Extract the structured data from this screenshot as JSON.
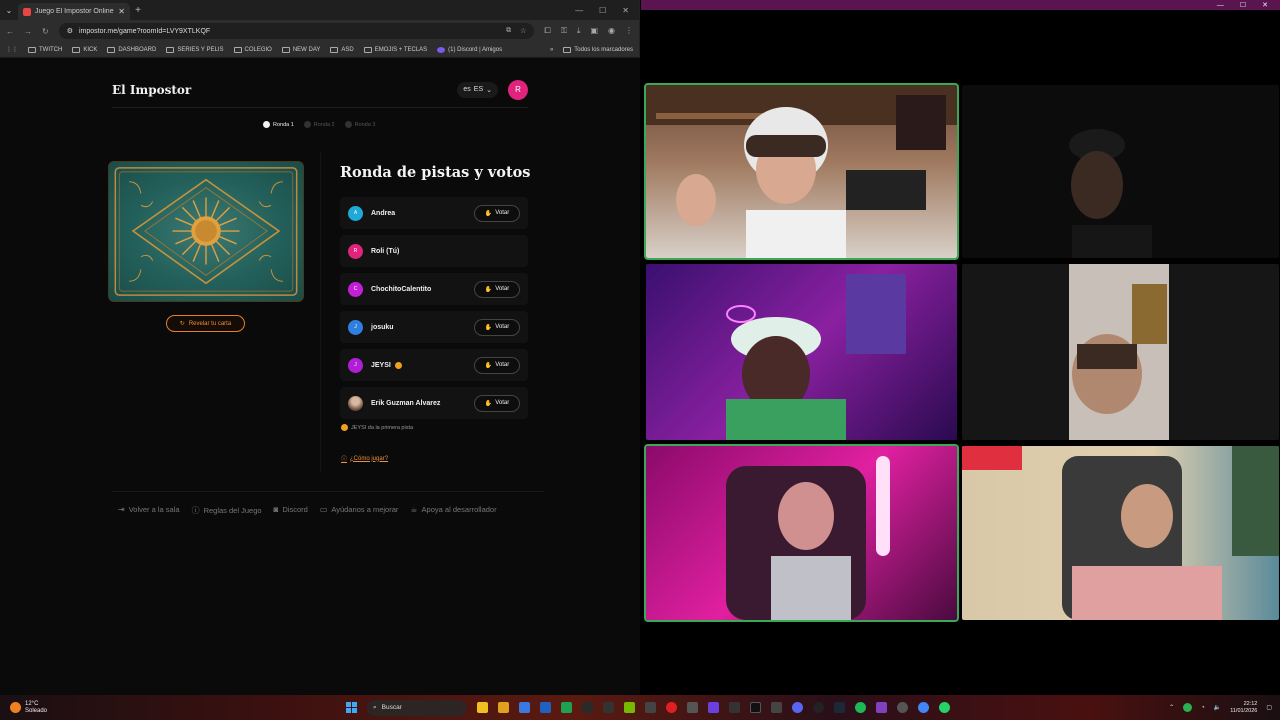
{
  "browser": {
    "tab_title": "Juego El Impostor Online - Jug",
    "url": "impostor.me/game?roomId=LVY9XTLKQF",
    "bookmarks": [
      "TWITCH",
      "KICK",
      "DASHBOARD",
      "SERIES Y PELIS",
      "COLEGIO",
      "NEW DAY",
      "ASD",
      "EMOJIS + TECLAS",
      "(1) Discord | Amigos"
    ],
    "all_bookmarks": "Todos los marcadores"
  },
  "site": {
    "logo": "El Impostor",
    "lang_code": "ES",
    "lang_flag": "es",
    "user_initial": "R",
    "steps": [
      {
        "label": "Ronda 1",
        "active": true
      },
      {
        "label": "Ronda 2",
        "active": false
      },
      {
        "label": "Ronda 3",
        "active": false
      }
    ],
    "reveal_label": "Revelar tu carta",
    "round_title": "Ronda de pistas y votos",
    "vote_label": "Votar",
    "players": [
      {
        "initial": "A",
        "name": "Andrea",
        "color": "#1fa9d6",
        "can_vote": true,
        "first": false
      },
      {
        "initial": "R",
        "name": "Roli (Tú)",
        "color": "#e0237c",
        "can_vote": false,
        "first": false
      },
      {
        "initial": "C",
        "name": "ChochitoCalentito",
        "color": "#c21fd6",
        "can_vote": true,
        "first": false
      },
      {
        "initial": "J",
        "name": "josuku",
        "color": "#2f7fe0",
        "can_vote": true,
        "first": false
      },
      {
        "initial": "J",
        "name": "JEYSI",
        "color": "#b01fd6",
        "can_vote": true,
        "first": true
      },
      {
        "initial": "",
        "name": "Erik Guzman Alvarez",
        "color": "#8a6a5a",
        "can_vote": true,
        "first": false
      }
    ],
    "hint": "JEYSI da la primera pista",
    "howto": "¿Cómo jugar?",
    "footer": [
      {
        "icon": "exit-icon",
        "label": "Volver a la sala"
      },
      {
        "icon": "info-icon",
        "label": "Reglas del Juego"
      },
      {
        "icon": "discord-icon",
        "label": "Discord"
      },
      {
        "icon": "feedback-icon",
        "label": "Ayúdanos a mejorar"
      },
      {
        "icon": "coffee-icon",
        "label": "Apoya al desarrollador"
      }
    ]
  },
  "taskbar": {
    "temp": "12°C",
    "weather": "Soleado",
    "search": "Buscar",
    "time": "22:12",
    "date": "11/01/2026"
  },
  "colors": {
    "accent": "#e08030",
    "call_titlebar": "#5a1550",
    "active_speaker": "#3aa857"
  }
}
